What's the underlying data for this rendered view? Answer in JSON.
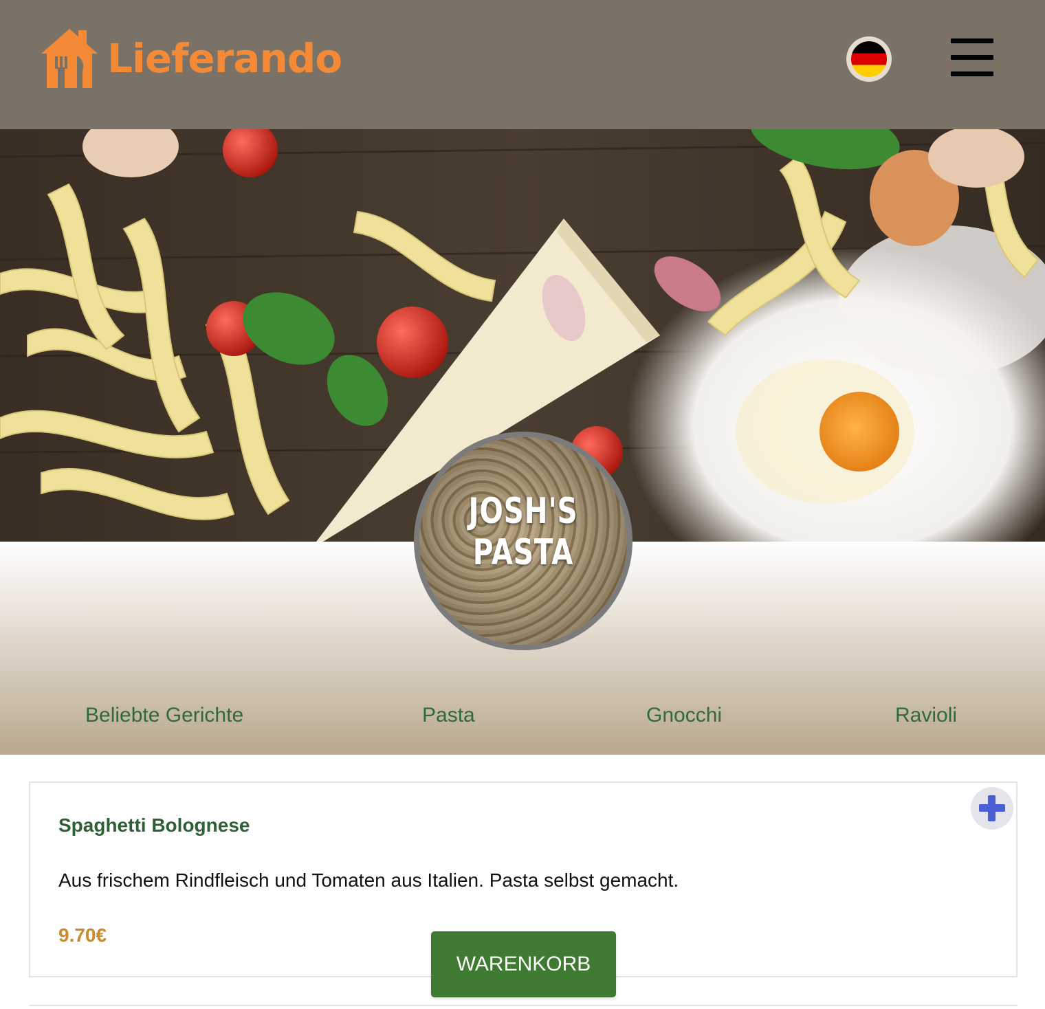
{
  "header": {
    "brand_name": "Lieferando",
    "brand_color": "#f58a36",
    "background_color": "#7a7266",
    "language_icon": "germany-flag-icon",
    "menu_icon": "hamburger-menu-icon"
  },
  "restaurant": {
    "logo_text": "JOSH'S PASTA"
  },
  "categories": [
    {
      "label": "Beliebte Gerichte"
    },
    {
      "label": "Pasta"
    },
    {
      "label": "Gnocchi"
    },
    {
      "label": "Ravioli"
    }
  ],
  "dishes": [
    {
      "title": "Spaghetti Bolognese",
      "description": "Aus frischem Rindfleisch und Tomaten aus Italien. Pasta selbst gemacht.",
      "price": "9.70€",
      "add_icon": "plus-icon"
    }
  ],
  "cart": {
    "label": "WARENKORB",
    "color": "#3f7a33"
  }
}
